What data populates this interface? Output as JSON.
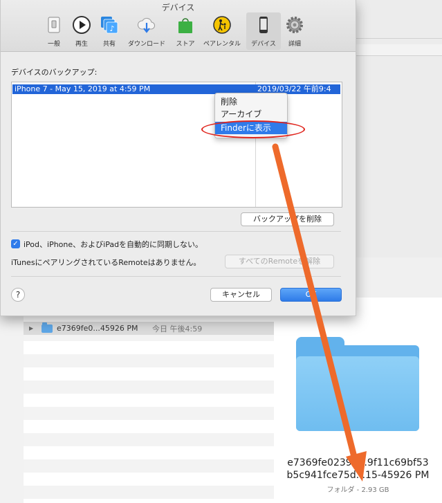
{
  "window": {
    "title": "デバイス"
  },
  "toolbar": {
    "items": [
      {
        "label": "一般",
        "icon": "general-switch-icon"
      },
      {
        "label": "再生",
        "icon": "play-icon"
      },
      {
        "label": "共有",
        "icon": "sharing-music-icon"
      },
      {
        "label": "ダウンロード",
        "icon": "cloud-download-icon"
      },
      {
        "label": "ストア",
        "icon": "store-bag-icon"
      },
      {
        "label": "ペアレンタル",
        "icon": "parental-icon"
      },
      {
        "label": "デバイス",
        "icon": "device-phone-icon",
        "selected": true
      },
      {
        "label": "詳細",
        "icon": "gear-icon"
      }
    ]
  },
  "backups": {
    "section_label": "デバイスのバックアップ:",
    "rows": [
      {
        "name": "iPhone 7 - May 15, 2019 at 4:59 PM",
        "date": "2019/03/22 午前9:4"
      }
    ],
    "context_menu": [
      "削除",
      "アーカイブ",
      "Finderに表示"
    ],
    "delete_button": "バックアップを削除"
  },
  "sync": {
    "checkbox_label": "iPod、iPhone、およびiPadを自動的に同期しない。",
    "checkbox_checked": true,
    "remote_label": "iTunesにペアリングされているRemoteはありません。",
    "remote_button": "すべてのRemoteを解除"
  },
  "footer": {
    "help": "?",
    "cancel": "キャンセル",
    "ok": "OK"
  },
  "finder": {
    "row_name": "e7369fe0...45926 PM",
    "row_date": "今日 午後4:59",
    "preview_name_line1": "e7369fe0239b...9f11c69bf53",
    "preview_name_line2": "b5c941fce75d...15-45926 PM",
    "preview_meta": "フォルダ - 2.93 GB"
  },
  "colors": {
    "selection_blue": "#2265d8",
    "annotation_red": "#e0261e",
    "arrow_orange": "#ee6a2b",
    "folder_blue": "#62b2ec"
  }
}
